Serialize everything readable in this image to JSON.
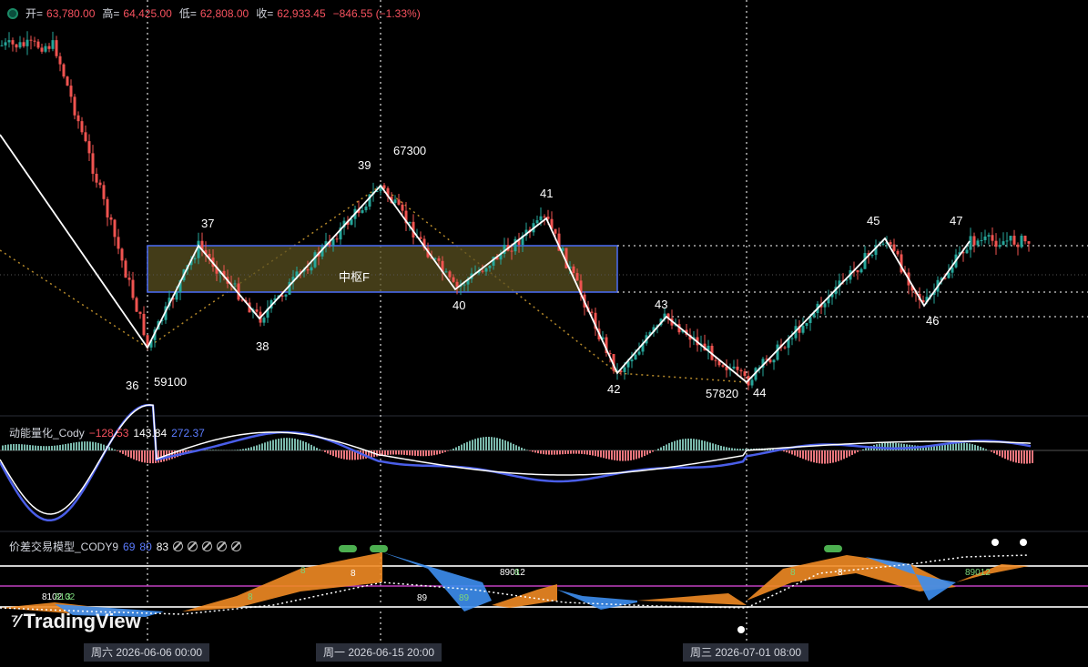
{
  "header": {
    "open_label": "开=",
    "open_value": "63,780.00",
    "high_label": "高=",
    "high_value": "64,425.00",
    "low_label": "低=",
    "low_value": "62,808.00",
    "close_label": "收=",
    "close_value": "62,933.45",
    "change_value": "−846.55 (−1.33%)"
  },
  "indicator1": {
    "name": "动能量化_Cody",
    "v1": "−128.53",
    "v2": "143.84",
    "v3": "272.37"
  },
  "indicator2": {
    "name": "价差交易模型_CODY9",
    "v1": "69",
    "v2": "80",
    "v3": "83"
  },
  "watermark": {
    "text": "TradingView",
    "icon": "tradingview-logo-icon"
  },
  "x_axis": {
    "crosshair_labels": [
      "周六 2026-06-06   00:00",
      "周一 2026-06-15   20:00",
      "周三 2026-07-01   08:00"
    ]
  },
  "colors": {
    "up": "#26a69a",
    "down": "#ef5350",
    "zone_border": "#4a6cf7",
    "zone_fill": "#5a5020",
    "macd_fast": "#ffffff",
    "macd_slow": "#4a5ee8",
    "fill_orange": "#f08a24",
    "fill_blue": "#3d8ef0"
  },
  "chart_data": {
    "type": "line",
    "title": "",
    "wave_points": [
      {
        "label": "36",
        "price_label": "59100"
      },
      {
        "label": "37"
      },
      {
        "label": "38"
      },
      {
        "label": "39",
        "price_label": "67300"
      },
      {
        "label": "40"
      },
      {
        "label": "41"
      },
      {
        "label": "42"
      },
      {
        "label": "43"
      },
      {
        "label": "44",
        "price_label": "57820"
      },
      {
        "label": "45"
      },
      {
        "label": "46"
      },
      {
        "label": "47"
      }
    ],
    "zone": {
      "label": "中枢F"
    },
    "osc2_numbers": [
      "8102",
      "8102",
      "3",
      "8",
      "8",
      "8",
      "89",
      "89",
      "8",
      "89012",
      "8",
      "89012",
      "8"
    ]
  }
}
